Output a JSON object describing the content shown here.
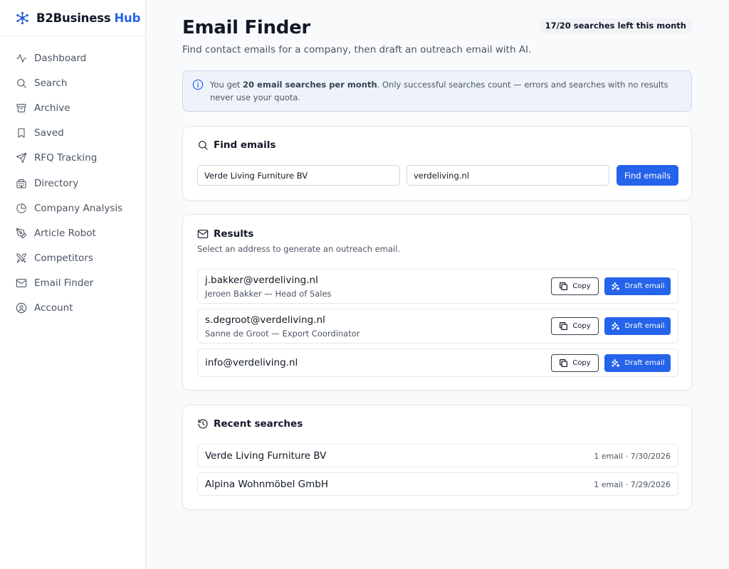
{
  "app": {
    "name": "B2Business",
    "name_accent": "Hub",
    "accent_color": "#2563eb"
  },
  "sidebar": {
    "items": [
      {
        "label": "Dashboard",
        "icon": "activity-icon"
      },
      {
        "label": "Search",
        "icon": "search-icon"
      },
      {
        "label": "Archive",
        "icon": "archive-icon"
      },
      {
        "label": "Saved",
        "icon": "bookmark-icon"
      },
      {
        "label": "RFQ Tracking",
        "icon": "send-icon"
      },
      {
        "label": "Directory",
        "icon": "building-icon"
      },
      {
        "label": "Company Analysis",
        "icon": "pie-chart-icon"
      },
      {
        "label": "Article Robot",
        "icon": "pen-tool-icon"
      },
      {
        "label": "Competitors",
        "icon": "swords-icon"
      },
      {
        "label": "Email Finder",
        "icon": "mail-icon"
      },
      {
        "label": "Account",
        "icon": "user-circle-icon"
      }
    ]
  },
  "page": {
    "title": "Email Finder",
    "subtitle": "Find contact emails for a company, then draft an outreach email with AI.",
    "quota_badge": "17/20 searches left this month"
  },
  "info": {
    "prefix": "You get ",
    "bold": "20 email searches per month",
    "suffix": ". Only successful searches count — errors and searches with no results never use your quota."
  },
  "find": {
    "heading": "Find emails",
    "company_value": "Verde Living Furniture BV",
    "domain_value": "verdeliving.nl",
    "button_label": "Find emails"
  },
  "results": {
    "heading": "Results",
    "subtitle": "Select an address to generate an outreach email.",
    "copy_label": "Copy",
    "draft_label": "Draft email",
    "items": [
      {
        "email": "j.bakker@verdeliving.nl",
        "meta": "Jeroen Bakker — Head of Sales"
      },
      {
        "email": "s.degroot@verdeliving.nl",
        "meta": "Sanne de Groot — Export Coordinator"
      },
      {
        "email": "info@verdeliving.nl",
        "meta": ""
      }
    ]
  },
  "recent": {
    "heading": "Recent searches",
    "items": [
      {
        "name": "Verde Living Furniture BV",
        "meta": "1 email · 7/30/2026"
      },
      {
        "name": "Alpina Wohnmöbel GmbH",
        "meta": "1 email · 7/29/2026"
      }
    ]
  }
}
